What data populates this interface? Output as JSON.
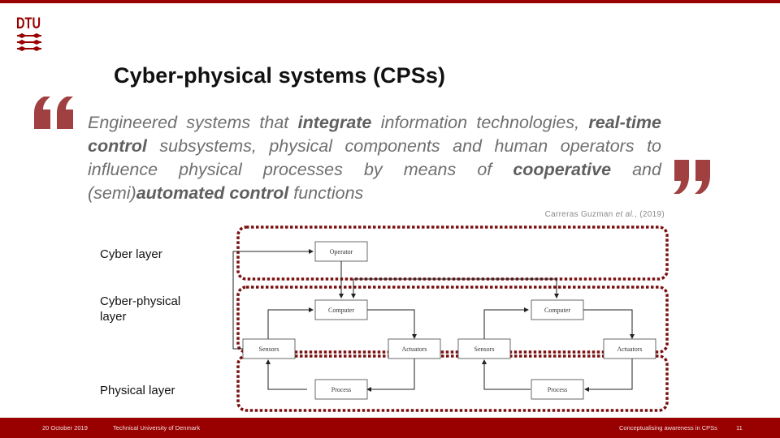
{
  "brand": {
    "logo_text": "DTU",
    "logo_icon": "dtu-logo-icon",
    "accent_color": "#990000",
    "quote_color": "#a04040",
    "layer_border_color": "#7a1010"
  },
  "slide": {
    "title": "Cyber-physical systems (CPSs)",
    "quote": {
      "open_icon": "open-quote-icon",
      "close_icon": "close-quote-icon",
      "segments": [
        {
          "text": "Engineered systems that ",
          "bold": false
        },
        {
          "text": "integrate",
          "bold": true
        },
        {
          "text": " information technologies, ",
          "bold": false
        },
        {
          "text": "real-time control",
          "bold": true
        },
        {
          "text": " subsystems, physical components and human operators to influence physical processes by means of ",
          "bold": false
        },
        {
          "text": "cooperative",
          "bold": true
        },
        {
          "text": " and (semi)",
          "bold": false
        },
        {
          "text": "automated control",
          "bold": true
        },
        {
          "text": " functions",
          "bold": false
        }
      ],
      "citation_prefix": "Carreras Guzman ",
      "citation_etal": "et al.",
      "citation_suffix": ", (2019)"
    },
    "layers": [
      {
        "label": "Cyber layer"
      },
      {
        "label": "Cyber-physical layer"
      },
      {
        "label": "Physical layer"
      }
    ],
    "diagram": {
      "nodes": {
        "operator": "Operator",
        "computer_left": "Computer",
        "computer_right": "Computer",
        "sensors_left": "Sensors",
        "actuators_left": "Actuators",
        "sensors_right": "Sensors",
        "actuators_right": "Actuators",
        "process_left": "Process",
        "process_right": "Process"
      }
    }
  },
  "footer": {
    "date": "20 October 2019",
    "institution": "Technical University of Denmark",
    "presentation_title": "Conceptualising awareness in CPSs",
    "page_number": "11"
  }
}
